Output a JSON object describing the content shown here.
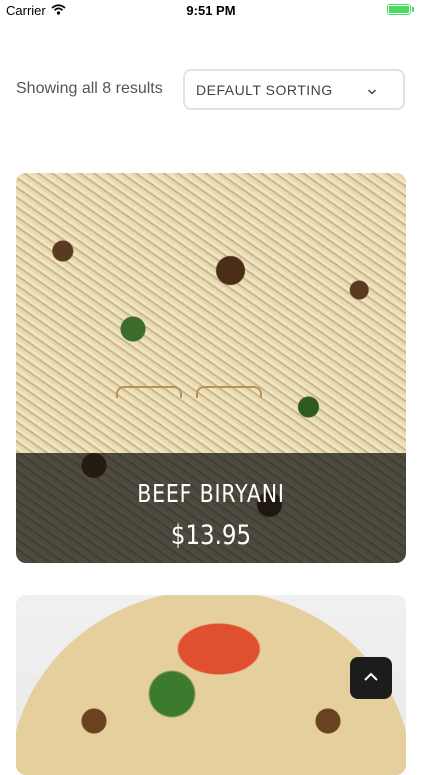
{
  "status_bar": {
    "carrier": "Carrier",
    "time": "9:51 PM",
    "battery_level": 1.0,
    "battery_color": "#4cd964"
  },
  "results": {
    "count_text": "Showing all 8 results"
  },
  "sorting": {
    "selected": "DEFAULT SORTING",
    "icon": "chevron-down-icon"
  },
  "products": [
    {
      "title": "BEEF BIRYANI",
      "price": "$13.95",
      "image": "biryani-image"
    },
    {
      "image": "biryani-image"
    }
  ],
  "back_to_top": {
    "icon": "chevron-up-icon"
  }
}
